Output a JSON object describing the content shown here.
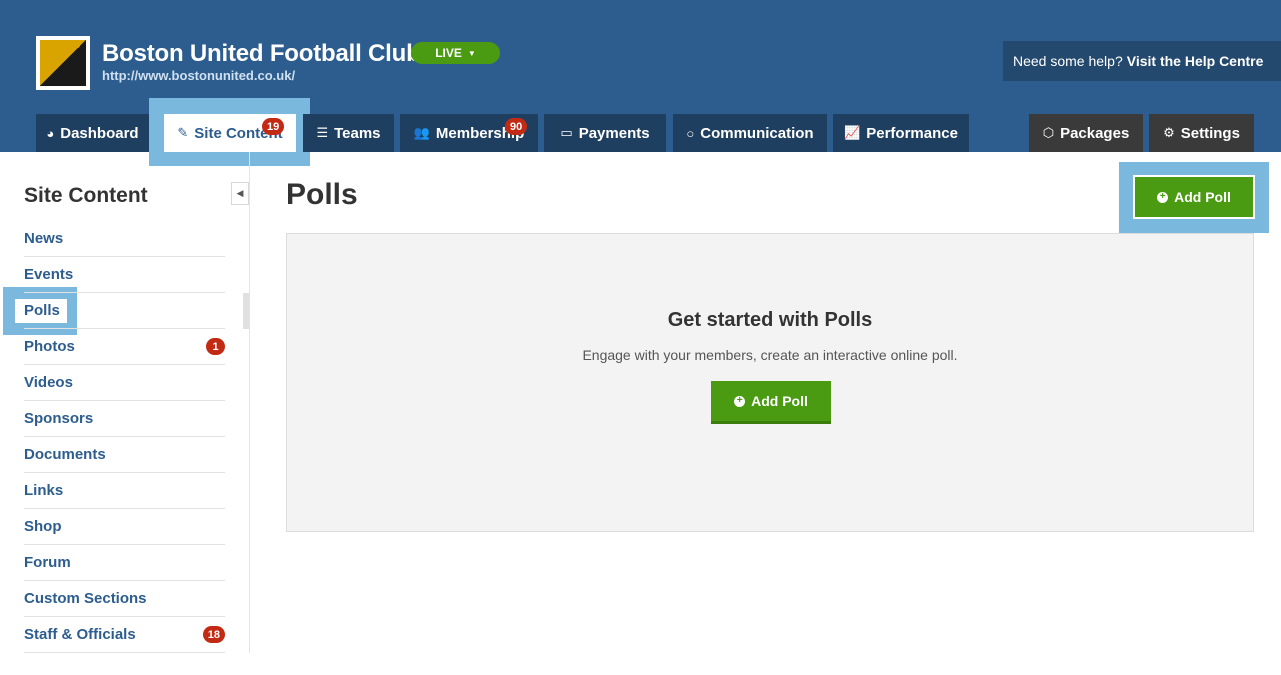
{
  "header": {
    "club_name": "Boston United Football Club",
    "club_url": "http://www.bostonunited.co.uk/",
    "live_label": "LIVE",
    "help_text": "Need some help?",
    "help_link": "Visit the Help Centre"
  },
  "tabs": [
    {
      "label": "Dashboard",
      "icon": "dashboard-icon"
    },
    {
      "label": "Site Content",
      "icon": "pencil-icon",
      "badge": "19",
      "active": true
    },
    {
      "label": "Teams",
      "icon": "list-icon"
    },
    {
      "label": "Membership",
      "icon": "users-icon",
      "badge": "90"
    },
    {
      "label": "Payments",
      "icon": "credit-card-icon"
    },
    {
      "label": "Communication",
      "icon": "speech-bubble-icon"
    },
    {
      "label": "Performance",
      "icon": "chart-icon"
    },
    {
      "label": "Packages",
      "icon": "cube-icon"
    },
    {
      "label": "Settings",
      "icon": "gear-icon"
    }
  ],
  "sidebar": {
    "title": "Site Content",
    "items": [
      {
        "label": "News"
      },
      {
        "label": "Events"
      },
      {
        "label": "Polls",
        "active": true
      },
      {
        "label": "Photos",
        "badge": "1"
      },
      {
        "label": "Videos"
      },
      {
        "label": "Sponsors"
      },
      {
        "label": "Documents"
      },
      {
        "label": "Links"
      },
      {
        "label": "Shop"
      },
      {
        "label": "Forum"
      },
      {
        "label": "Custom Sections"
      },
      {
        "label": "Staff & Officials",
        "badge": "18"
      }
    ]
  },
  "main": {
    "title": "Polls",
    "add_button": "Add Poll",
    "empty_title": "Get started with Polls",
    "empty_subtitle": "Engage with your members, create an interactive online poll.",
    "empty_button": "Add Poll"
  },
  "colors": {
    "header_bg": "#2d5d8e",
    "tab_bg": "#1f3f60",
    "accent_green": "#4a9a12",
    "badge_red": "#c22a14",
    "highlight": "#7ab8de"
  }
}
